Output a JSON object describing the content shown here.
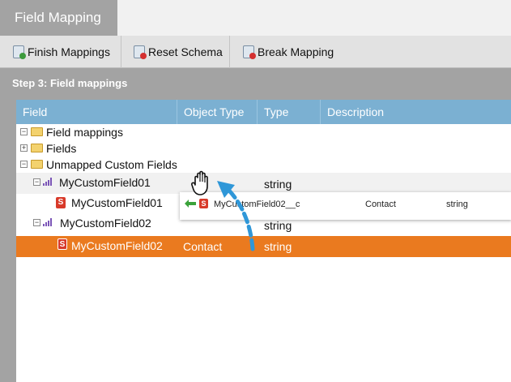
{
  "tab": {
    "label": "Field Mapping"
  },
  "toolbar": {
    "finish": "Finish Mappings",
    "reset": "Reset Schema",
    "break": "Break Mapping"
  },
  "step": {
    "title": "Step 3: Field mappings"
  },
  "grid": {
    "headers": {
      "field": "Field",
      "object_type": "Object Type",
      "type": "Type",
      "description": "Description"
    },
    "rows": [
      {
        "field": "Field mappings",
        "object_type": "",
        "type": ""
      },
      {
        "field": "Fields",
        "object_type": "",
        "type": ""
      },
      {
        "field": "Unmapped Custom Fields",
        "object_type": "",
        "type": ""
      },
      {
        "field": "MyCustomField01",
        "object_type": "",
        "type": "string"
      },
      {
        "field": "MyCustomField01",
        "object_type": "",
        "type": ""
      },
      {
        "field": "MyCustomField02",
        "object_type": "",
        "type": "string"
      },
      {
        "field": "MyCustomField02",
        "object_type": "Contact",
        "type": "string"
      }
    ]
  },
  "drag": {
    "field": "MyCustomField02__c",
    "object_type": "Contact",
    "type": "string"
  },
  "colors": {
    "header": "#7bb0d2",
    "selected": "#ea7a1f",
    "arrow": "#2f97d8"
  },
  "icons": {
    "s_badge": "S"
  }
}
